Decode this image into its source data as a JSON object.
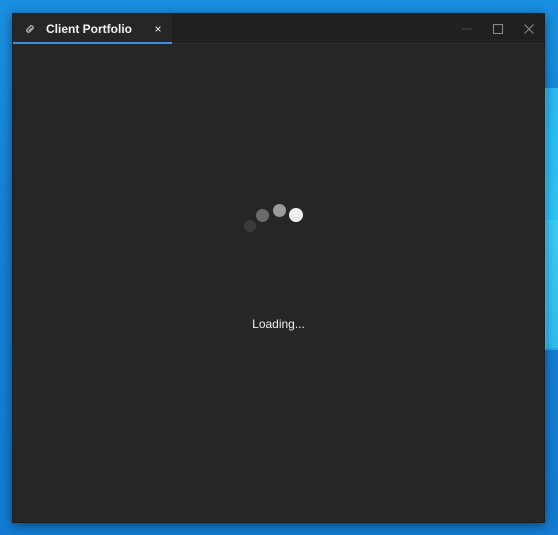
{
  "window": {
    "tab_title": "Client Portfolio",
    "tab_icon": "link-icon",
    "close_tab_label": "×"
  },
  "window_controls": {
    "minimize_icon": "minimize-icon",
    "maximize_icon": "maximize-icon",
    "close_icon": "close-icon"
  },
  "status": {
    "loading_text": "Loading..."
  },
  "colors": {
    "desktop_blue": "#1585d8",
    "window_background": "#262626",
    "titlebar_background": "#202020",
    "tab_accent": "#3d8fe3",
    "text_primary": "#f3f3f3",
    "spinner_dark": "#3a3a3a",
    "spinner_mid": "#6b6b6b",
    "spinner_light": "#9c9c9c",
    "spinner_bright": "#eeeeee"
  }
}
